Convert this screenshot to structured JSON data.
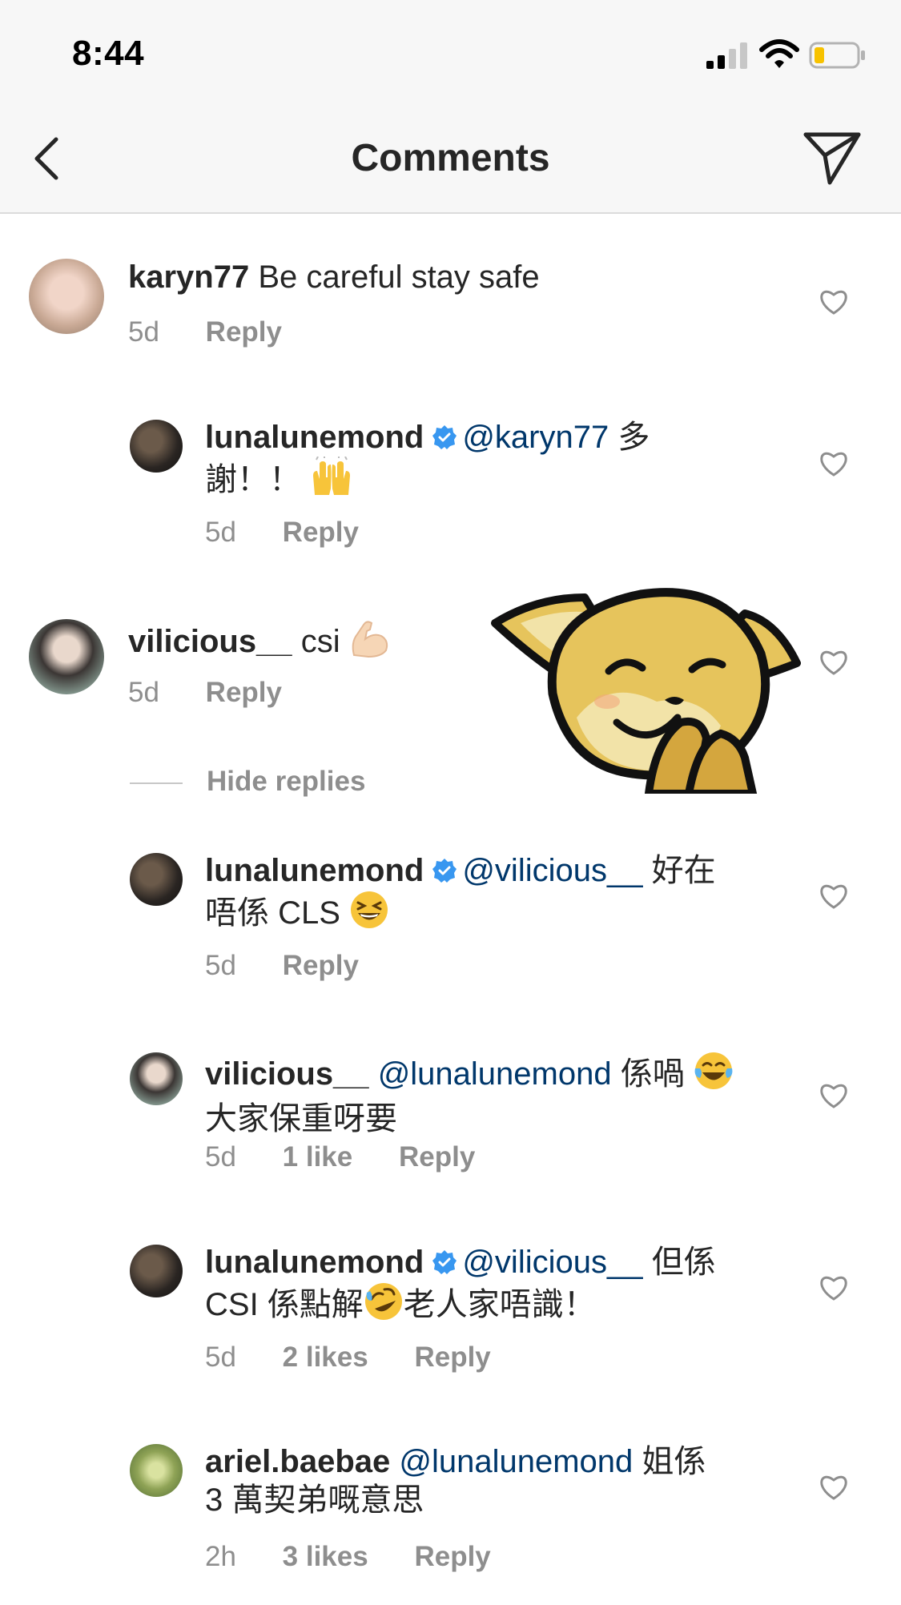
{
  "status": {
    "time": "8:44"
  },
  "nav": {
    "title": "Comments"
  },
  "colors": {
    "mention": "#00376b",
    "muted": "#8e8e8e",
    "verified": "#3897f0"
  },
  "comments": [
    {
      "user": "karyn77",
      "text": "Be careful stay safe",
      "age": "5d",
      "reply": "Reply"
    },
    {
      "user": "lunalunemond",
      "verified": true,
      "mention": "@karyn77",
      "text": " 多",
      "text2": "謝！！",
      "age": "5d",
      "reply": "Reply"
    },
    {
      "user": "vilicious__",
      "text": "csi",
      "age": "5d",
      "reply": "Reply"
    },
    {
      "user": "lunalunemond",
      "verified": true,
      "mention": "@vilicious__",
      "text": " 好在",
      "text2": "唔係 CLS",
      "age": "5d",
      "reply": "Reply"
    },
    {
      "user": "vilicious__",
      "mention": "@lunalunemond",
      "text": " 係喎",
      "text2": "大家保重呀要",
      "age": "5d",
      "likes": "1 like",
      "reply": "Reply"
    },
    {
      "user": "lunalunemond",
      "verified": true,
      "mention": "@vilicious__",
      "text": " 但係",
      "text2": "CSI 係點解",
      "text3": "老人家唔識！",
      "age": "5d",
      "likes": "2 likes",
      "reply": "Reply"
    },
    {
      "user": "ariel.baebae",
      "mention": "@lunalunemond",
      "text": " 姐係",
      "text2": "3 萬契弟嘅意思",
      "age": "2h",
      "likes": "3 likes",
      "reply": "Reply"
    }
  ],
  "hide_replies": "Hide replies",
  "icons": [
    "back-icon",
    "send-icon",
    "heart-icon",
    "verified-badge-icon",
    "signal-icon",
    "wifi-icon",
    "battery-icon",
    "shiba-sticker"
  ]
}
